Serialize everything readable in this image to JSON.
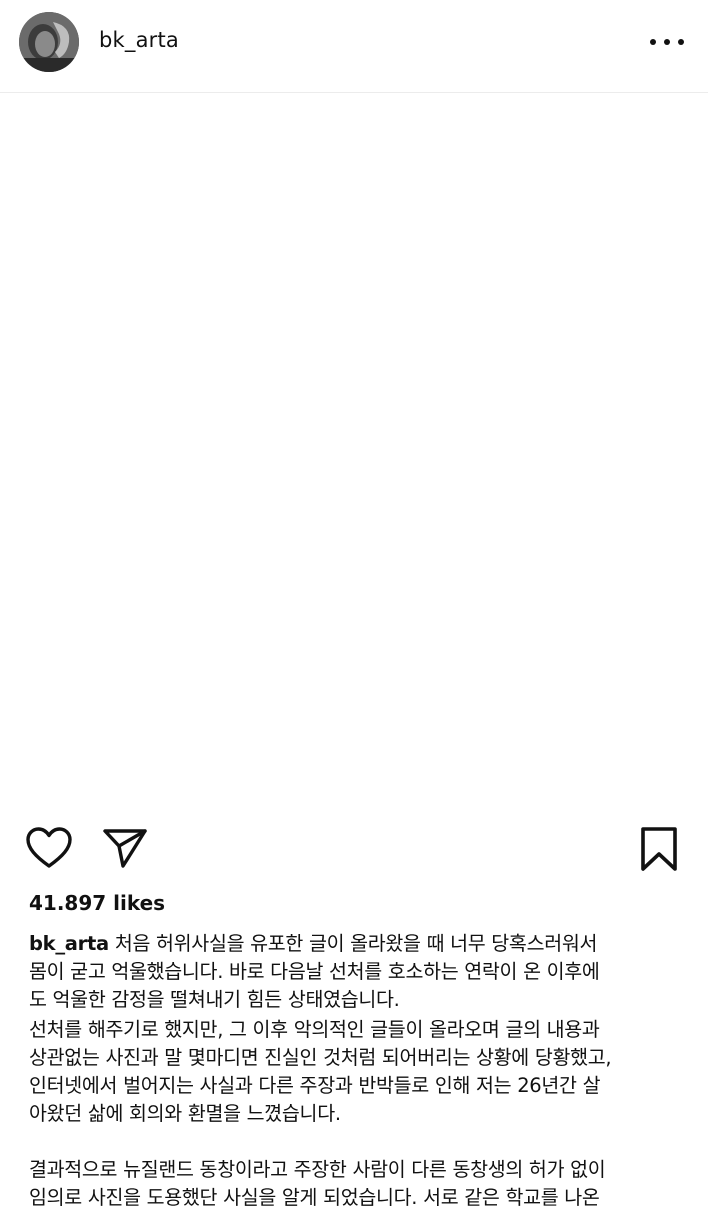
{
  "post": {
    "username": "bk_arta",
    "likes": "41.897 likes",
    "caption": {
      "p1_lines": [
        "처음 허위사실을 유포한 글이 올라왔을 때 너무 당혹스러워서",
        "몸이 굳고 억울했습니다. 바로 다음날 선처를 호소하는 연락이 온 이후에",
        "도 억울한 감정을 떨쳐내기 힘든 상태였습니다."
      ],
      "p2_lines": [
        "선처를 해주기로 했지만, 그 이후 악의적인 글들이 올라오며 글의 내용과",
        "상관없는 사진과 말 몇마디면 진실인 것처럼 되어버리는 상황에 당황했고,",
        "인터넷에서 벌어지는 사실과 다른 주장과 반박들로 인해 저는 26년간 살",
        "아왔던 삶에 회의와 환멸을 느꼈습니다."
      ],
      "p3_lines": [
        "결과적으로 뉴질랜드 동창이라고 주장한 사람이 다른 동창생의 허가 없이",
        "임의로 사진을 도용했단 사실을 알게 되었습니다. 서로 같은 학교를 나온"
      ]
    }
  },
  "icons": {
    "avatar": "profile-photo",
    "more": "more-options-icon",
    "like": "heart-icon",
    "share": "paper-plane-icon",
    "save": "bookmark-icon"
  }
}
